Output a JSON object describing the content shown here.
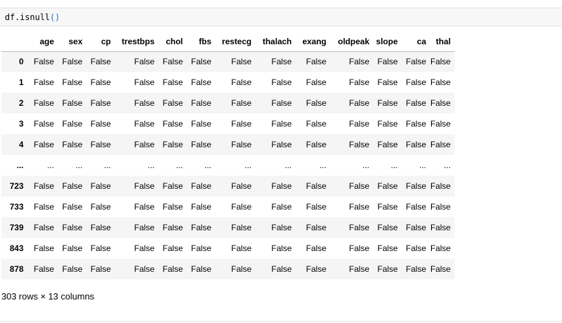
{
  "input": {
    "code_name": "df.isnull",
    "code_parens": "()"
  },
  "table": {
    "columns": [
      "age",
      "sex",
      "cp",
      "trestbps",
      "chol",
      "fbs",
      "restecg",
      "thalach",
      "exang",
      "oldpeak",
      "slope",
      "ca",
      "thal"
    ],
    "rows": [
      {
        "index": "0",
        "values": [
          "False",
          "False",
          "False",
          "False",
          "False",
          "False",
          "False",
          "False",
          "False",
          "False",
          "False",
          "False",
          "False"
        ]
      },
      {
        "index": "1",
        "values": [
          "False",
          "False",
          "False",
          "False",
          "False",
          "False",
          "False",
          "False",
          "False",
          "False",
          "False",
          "False",
          "False"
        ]
      },
      {
        "index": "2",
        "values": [
          "False",
          "False",
          "False",
          "False",
          "False",
          "False",
          "False",
          "False",
          "False",
          "False",
          "False",
          "False",
          "False"
        ]
      },
      {
        "index": "3",
        "values": [
          "False",
          "False",
          "False",
          "False",
          "False",
          "False",
          "False",
          "False",
          "False",
          "False",
          "False",
          "False",
          "False"
        ]
      },
      {
        "index": "4",
        "values": [
          "False",
          "False",
          "False",
          "False",
          "False",
          "False",
          "False",
          "False",
          "False",
          "False",
          "False",
          "False",
          "False"
        ]
      },
      {
        "index": "...",
        "values": [
          "...",
          "...",
          "...",
          "...",
          "...",
          "...",
          "...",
          "...",
          "...",
          "...",
          "...",
          "...",
          "..."
        ]
      },
      {
        "index": "723",
        "values": [
          "False",
          "False",
          "False",
          "False",
          "False",
          "False",
          "False",
          "False",
          "False",
          "False",
          "False",
          "False",
          "False"
        ]
      },
      {
        "index": "733",
        "values": [
          "False",
          "False",
          "False",
          "False",
          "False",
          "False",
          "False",
          "False",
          "False",
          "False",
          "False",
          "False",
          "False"
        ]
      },
      {
        "index": "739",
        "values": [
          "False",
          "False",
          "False",
          "False",
          "False",
          "False",
          "False",
          "False",
          "False",
          "False",
          "False",
          "False",
          "False"
        ]
      },
      {
        "index": "843",
        "values": [
          "False",
          "False",
          "False",
          "False",
          "False",
          "False",
          "False",
          "False",
          "False",
          "False",
          "False",
          "False",
          "False"
        ]
      },
      {
        "index": "878",
        "values": [
          "False",
          "False",
          "False",
          "False",
          "False",
          "False",
          "False",
          "False",
          "False",
          "False",
          "False",
          "False",
          "False"
        ]
      }
    ]
  },
  "summary": "303 rows × 13 columns"
}
